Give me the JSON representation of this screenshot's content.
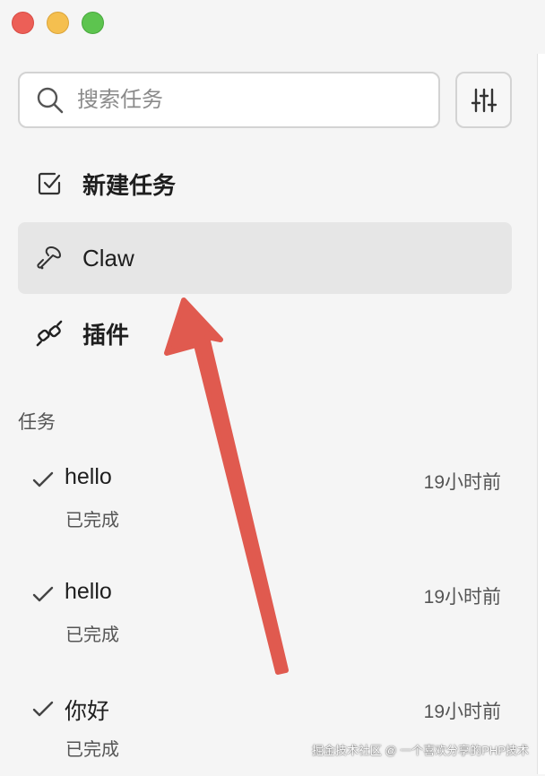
{
  "search": {
    "placeholder": "搜索任务"
  },
  "nav": {
    "new_task": "新建任务",
    "claw": "Claw",
    "plugins": "插件"
  },
  "tasks_section": {
    "title": "任务",
    "items": [
      {
        "name": "hello",
        "time": "19小时前",
        "status": "已完成"
      },
      {
        "name": "hello",
        "time": "19小时前",
        "status": "已完成"
      },
      {
        "name": "你好",
        "time": "19小时前",
        "status": "已完成"
      }
    ]
  },
  "watermark": "掘金技术社区 @ 一个喜欢分享的PHP技术",
  "colors": {
    "active_item_bg": "#e6e6e6",
    "arrow": "#e05a4f",
    "traffic_close": "#ec5f57",
    "traffic_minimize": "#f5bf4f",
    "traffic_maximize": "#5dc44f"
  }
}
